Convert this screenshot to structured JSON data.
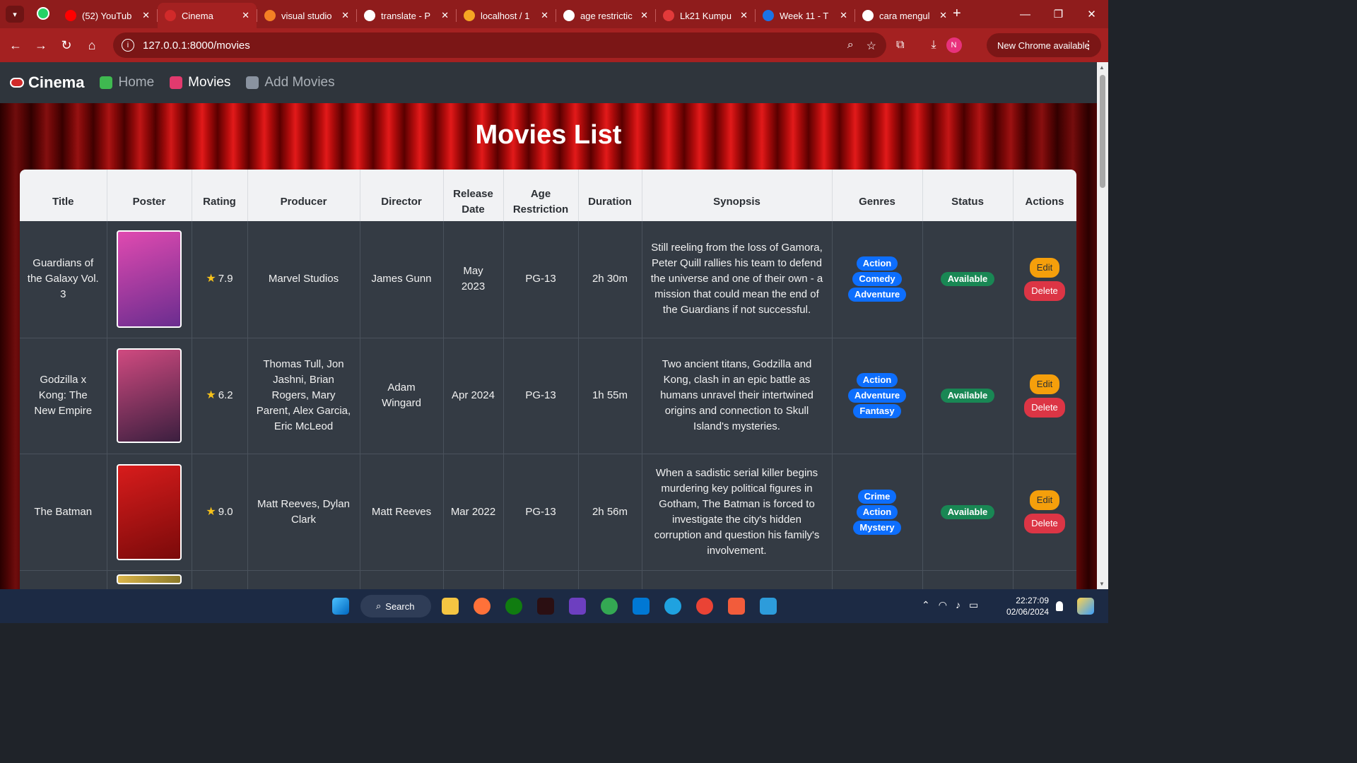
{
  "browser": {
    "tabs": [
      {
        "title": "(52) YouTub",
        "favicon_color": "#ff0000",
        "active": false
      },
      {
        "title": "Cinema",
        "favicon_color": "#d12a2a",
        "active": true
      },
      {
        "title": "visual studio",
        "favicon_color": "#f48024",
        "active": false
      },
      {
        "title": "translate - P",
        "favicon_color": "#ffffff",
        "active": false
      },
      {
        "title": "localhost / 1",
        "favicon_color": "#f5a623",
        "active": false
      },
      {
        "title": "age restrictic",
        "favicon_color": "#ffffff",
        "active": false
      },
      {
        "title": "Lk21 Kumpu",
        "favicon_color": "#e23a3a",
        "active": false
      },
      {
        "title": "Week 11 - T",
        "favicon_color": "#1a73e8",
        "active": false
      },
      {
        "title": "cara mengul",
        "favicon_color": "#ffffff",
        "active": false
      }
    ],
    "url": "127.0.0.1:8000/movies",
    "profile_initial": "N",
    "update_label": "New Chrome available"
  },
  "nav": {
    "brand": "Cinema",
    "links": [
      {
        "label": "Home",
        "active": false
      },
      {
        "label": "Movies",
        "active": true
      },
      {
        "label": "Add Movies",
        "active": false
      }
    ]
  },
  "page": {
    "title": "Movies List",
    "columns": [
      "Title",
      "Poster",
      "Rating",
      "Producer",
      "Director",
      "Release Date",
      "Age Restriction",
      "Duration",
      "Synopsis",
      "Genres",
      "Status",
      "Actions"
    ],
    "movies": [
      {
        "title": "Guardians of the Galaxy Vol. 3",
        "rating": "7.9",
        "producer": "Marvel Studios",
        "director": "James Gunn",
        "release_date": "May 2023",
        "age_restriction": "PG-13",
        "duration": "2h 30m",
        "synopsis": "Still reeling from the loss of Gamora, Peter Quill rallies his team to defend the universe and one of their own - a mission that could mean the end of the Guardians if not successful.",
        "genres": [
          "Action",
          "Comedy",
          "Adventure"
        ],
        "status": "Available",
        "poster_colors": [
          "#6a2d8f",
          "#e04ab0"
        ]
      },
      {
        "title": "Godzilla x Kong: The New Empire",
        "rating": "6.2",
        "producer": "Thomas Tull, Jon Jashni, Brian Rogers, Mary Parent, Alex Garcia, Eric McLeod",
        "director": "Adam Wingard",
        "release_date": "Apr 2024",
        "age_restriction": "PG-13",
        "duration": "1h 55m",
        "synopsis": "Two ancient titans, Godzilla and Kong, clash in an epic battle as humans unravel their intertwined origins and connection to Skull Island's mysteries.",
        "genres": [
          "Action",
          "Adventure",
          "Fantasy"
        ],
        "status": "Available",
        "poster_colors": [
          "#3b1f3f",
          "#d04a80"
        ]
      },
      {
        "title": "The Batman",
        "rating": "9.0",
        "producer": "Matt Reeves, Dylan Clark",
        "director": "Matt Reeves",
        "release_date": "Mar 2022",
        "age_restriction": "PG-13",
        "duration": "2h 56m",
        "synopsis": "When a sadistic serial killer begins murdering key political figures in Gotham, The Batman is forced to investigate the city's hidden corruption and question his family's involvement.",
        "genres": [
          "Crime",
          "Action",
          "Mystery"
        ],
        "status": "Available",
        "poster_colors": [
          "#7a0a0a",
          "#d81c1c"
        ]
      }
    ],
    "actions": {
      "edit": "Edit",
      "delete": "Delete"
    }
  },
  "taskbar": {
    "search_label": "Search",
    "time": "22:27:09",
    "date": "02/06/2024"
  }
}
